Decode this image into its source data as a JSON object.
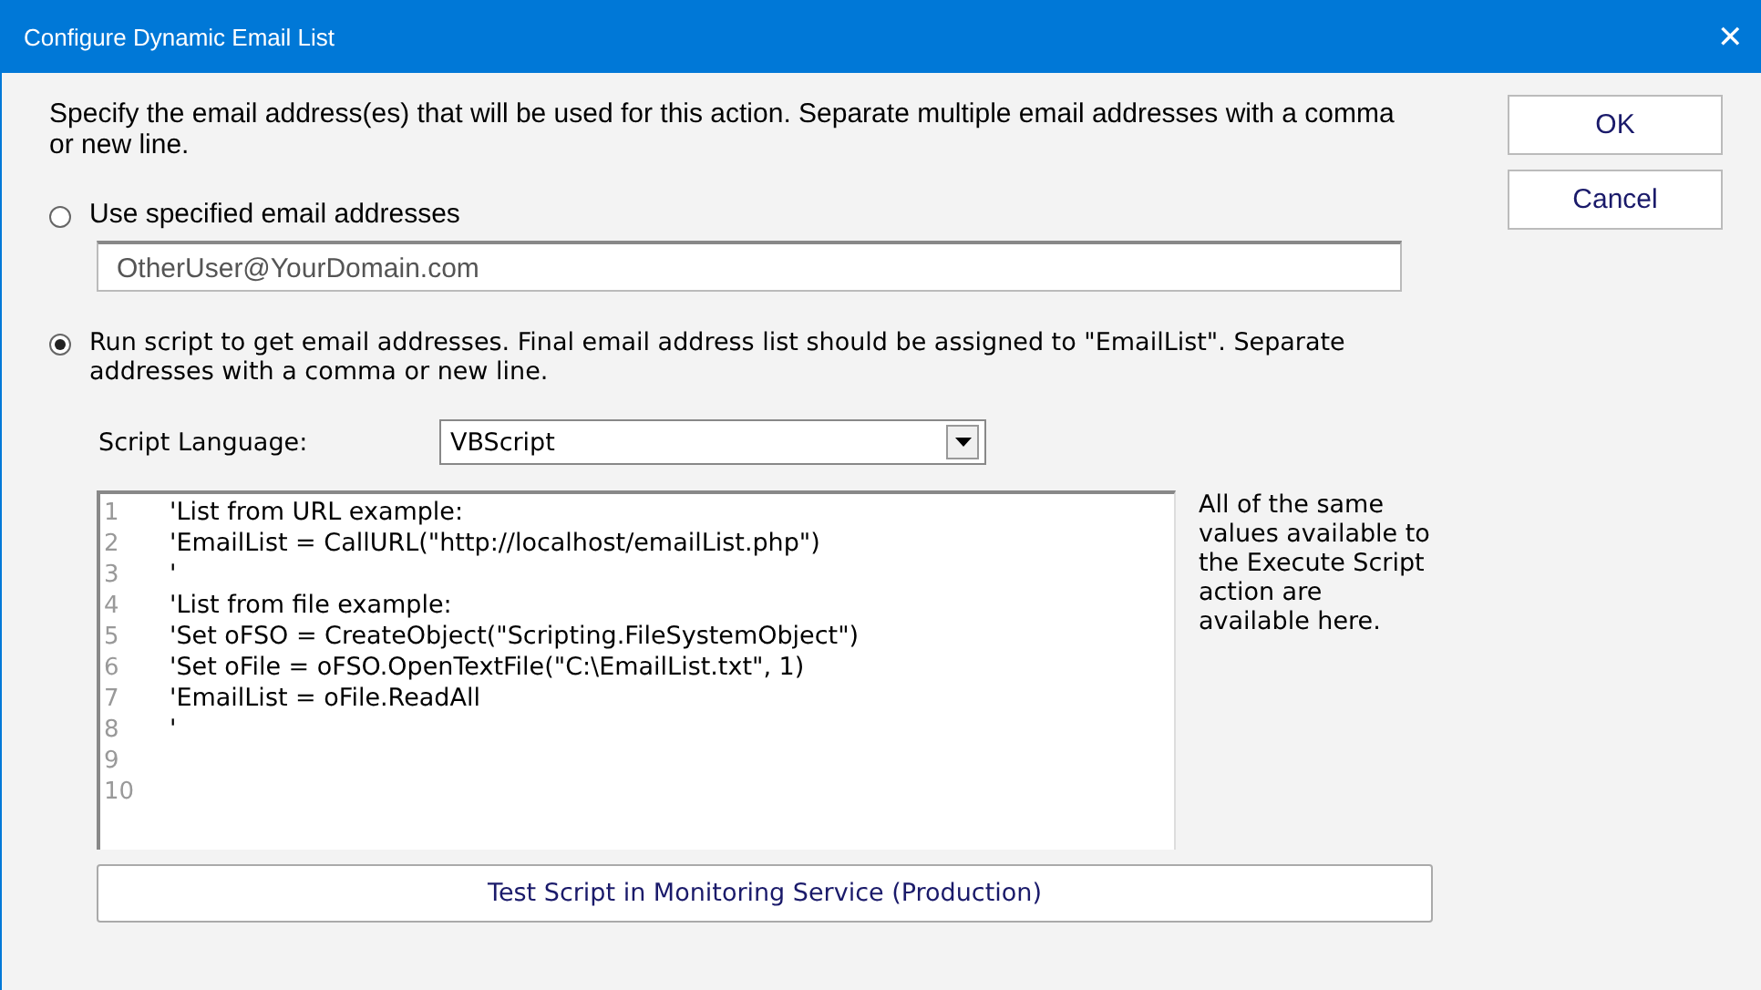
{
  "window": {
    "title": "Configure Dynamic Email List",
    "close": "✕"
  },
  "intro": "Specify the email address(es) that will be used for this action.  Separate multiple email addresses with a comma or new line.",
  "buttons": [
    {
      "label": "OK"
    },
    {
      "label": "Cancel"
    }
  ],
  "options": [
    {
      "label": "Use specified email addresses",
      "selected": false
    },
    {
      "label": "Run script to get email addresses.  Final email address list should be assigned to \"EmailList\".  Separate addresses with a comma or new line.",
      "selected": true
    }
  ],
  "email_field": {
    "value": "OtherUser@YourDomain.com"
  },
  "script_language": {
    "label": "Script Language:",
    "value": "VBScript"
  },
  "editor": {
    "lines": [
      {
        "number": "1",
        "code": "'List from URL example:"
      },
      {
        "number": "2",
        "code": "'EmailList = CallURL(\"http://localhost/emailList.php\")"
      },
      {
        "number": "3",
        "code": "'"
      },
      {
        "number": "4",
        "code": "'List from file example:"
      },
      {
        "number": "5",
        "code": "'Set oFSO = CreateObject(\"Scripting.FileSystemObject\")"
      },
      {
        "number": "6",
        "code": "'Set oFile = oFSO.OpenTextFile(\"C:\\EmailList.txt\", 1)"
      },
      {
        "number": "7",
        "code": "'EmailList = oFile.ReadAll"
      },
      {
        "number": "8",
        "code": "'"
      },
      {
        "number": "9"
      },
      {
        "number": "10"
      }
    ]
  },
  "side_note": "All of the same values available to the Execute Script action are available here.",
  "test_button": "Test Script in Monitoring Service (Production)"
}
